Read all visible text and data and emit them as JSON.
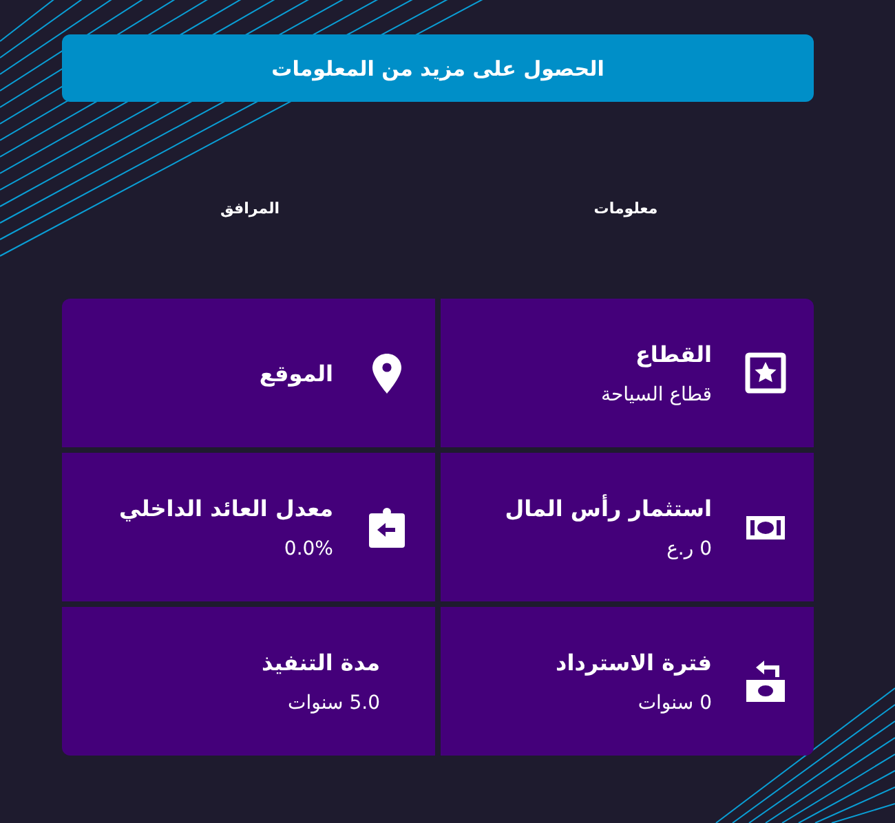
{
  "action_button": {
    "label": "الحصول على مزيد من المعلومات"
  },
  "tabs": [
    {
      "label": "معلومات"
    },
    {
      "label": "المرافق"
    }
  ],
  "cards": [
    {
      "title": "القطاع",
      "value": "قطاع السياحة"
    },
    {
      "title": "الموقع"
    },
    {
      "title": "استثمار رأس المال",
      "value": "0 ر.ع"
    },
    {
      "title": "معدل العائد الداخلي",
      "value": "0.0%"
    },
    {
      "title": "فترة الاسترداد",
      "value": "0 سنوات"
    },
    {
      "title": "مدة التنفيذ",
      "value": "5.0 سنوات"
    }
  ]
}
